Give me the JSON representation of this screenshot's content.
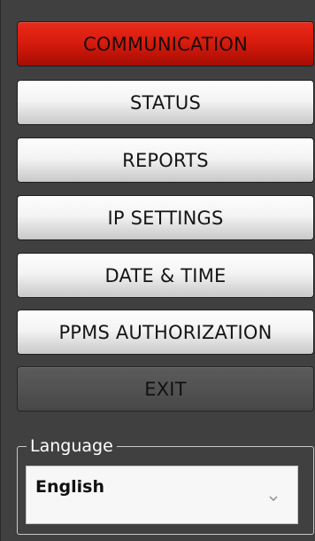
{
  "menu": {
    "communication": "COMMUNICATION",
    "status": "STATUS",
    "reports": "REPORTS",
    "ip_settings": "IP SETTINGS",
    "date_time": "DATE & TIME",
    "ppms_authorization": "PPMS AUTHORIZATION",
    "exit": "EXIT",
    "active_item": "COMMUNICATION"
  },
  "language": {
    "legend": "Language",
    "selected": "English",
    "icon": "chevron-down-icon"
  },
  "colors": {
    "active": "#d81c0e",
    "button_light": "#f0f0f0",
    "exit_button": "#525252",
    "panel_background": "#404040"
  }
}
